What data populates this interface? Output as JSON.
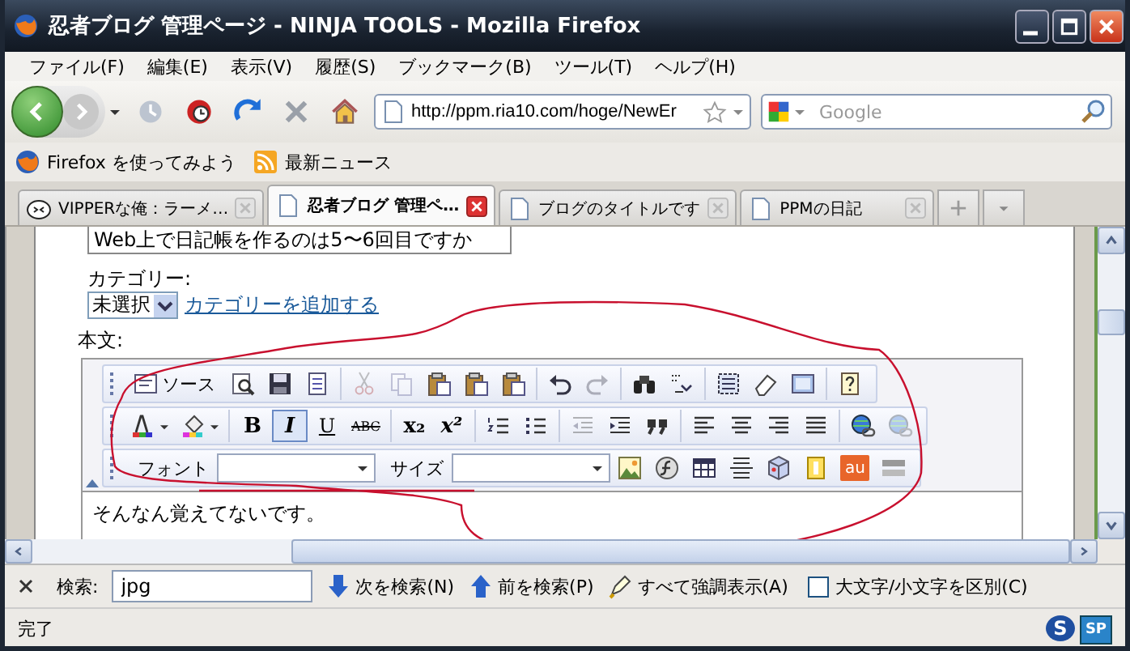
{
  "window": {
    "title": "忍者ブログ 管理ページ - NINJA TOOLS - Mozilla Firefox"
  },
  "menu": [
    "ファイル(F)",
    "編集(E)",
    "表示(V)",
    "履歴(S)",
    "ブックマーク(B)",
    "ツール(T)",
    "ヘルプ(H)"
  ],
  "address": {
    "value": "http://ppm.ria10.com/hoge/NewEr"
  },
  "search": {
    "placeholder": "Google"
  },
  "bookmarks": [
    {
      "kind": "firefox",
      "label": "Firefox を使ってみよう"
    },
    {
      "kind": "feed",
      "label": "最新ニュース"
    }
  ],
  "tabs": [
    {
      "kind": "site",
      "label": "VIPPERな俺：ラーメ…",
      "selected": false
    },
    {
      "kind": "page",
      "label": "忍者ブログ 管理ペ…",
      "selected": true
    },
    {
      "kind": "page",
      "label": "ブログのタイトルです",
      "selected": false
    },
    {
      "kind": "page",
      "label": "PPMの日記",
      "selected": false
    }
  ],
  "form": {
    "title_value": "Web上で日記帳を作るのは5〜6回目ですか",
    "category_label": "カテゴリー:",
    "category_value": "未選択",
    "category_link": "カテゴリーを追加する",
    "body_label": "本文:"
  },
  "editor": {
    "toolbars": [
      [
        [
          {
            "kind": "source",
            "label": "ソース",
            "disabled": false,
            "on": false
          },
          {
            "kind": "preview",
            "disabled": false,
            "on": false
          },
          {
            "kind": "save",
            "disabled": false,
            "on": false
          },
          {
            "kind": "template",
            "disabled": false,
            "on": false
          }
        ],
        [
          {
            "kind": "cut",
            "disabled": true,
            "on": false
          },
          {
            "kind": "copy",
            "disabled": true,
            "on": false
          },
          {
            "kind": "paste",
            "disabled": false,
            "on": false
          },
          {
            "kind": "paste",
            "disabled": false,
            "on": false
          },
          {
            "kind": "paste",
            "disabled": false,
            "on": false
          }
        ],
        [
          {
            "kind": "undo",
            "disabled": false,
            "on": false
          },
          {
            "kind": "redo",
            "disabled": true,
            "on": false
          }
        ],
        [
          {
            "kind": "find",
            "disabled": false,
            "on": false
          },
          {
            "kind": "replace",
            "disabled": false,
            "on": false
          }
        ],
        [
          {
            "kind": "select-all",
            "disabled": false,
            "on": false
          },
          {
            "kind": "eraser",
            "disabled": false,
            "on": false
          },
          {
            "kind": "frame",
            "disabled": false,
            "on": false
          }
        ],
        [
          {
            "kind": "help",
            "disabled": false,
            "on": false
          }
        ]
      ],
      [
        [
          {
            "kind": "text-color",
            "disabled": false,
            "on": false
          },
          {
            "kind": "bg-color",
            "disabled": false,
            "on": false
          }
        ],
        [
          {
            "kind": "glyph",
            "label": "B",
            "disabled": false,
            "on": false
          },
          {
            "kind": "glyph",
            "label": "I",
            "disabled": false,
            "on": true
          },
          {
            "kind": "glyph",
            "label": "U",
            "disabled": false,
            "on": false
          },
          {
            "kind": "glyph",
            "label": "ABC",
            "disabled": false,
            "on": false
          }
        ],
        [
          {
            "kind": "glyph",
            "label": "x₂",
            "disabled": false,
            "on": false
          },
          {
            "kind": "glyph",
            "label": "x²",
            "disabled": false,
            "on": false
          }
        ],
        [
          {
            "kind": "numbered-list",
            "disabled": false,
            "on": false
          },
          {
            "kind": "bullet-list",
            "disabled": false,
            "on": false
          }
        ],
        [
          {
            "kind": "outdent",
            "disabled": true,
            "on": false
          },
          {
            "kind": "indent",
            "disabled": false,
            "on": false
          },
          {
            "kind": "quote",
            "disabled": false,
            "on": false
          }
        ],
        [
          {
            "kind": "align-left",
            "disabled": false,
            "on": false
          },
          {
            "kind": "align-center",
            "disabled": false,
            "on": false
          },
          {
            "kind": "align-right",
            "disabled": false,
            "on": false
          },
          {
            "kind": "align-justify",
            "disabled": false,
            "on": false
          }
        ],
        [
          {
            "kind": "link",
            "disabled": false,
            "on": false
          },
          {
            "kind": "link",
            "disabled": true,
            "on": false
          }
        ]
      ],
      [
        [
          {
            "kind": "label",
            "label": "フォント",
            "disabled": false
          },
          {
            "kind": "select",
            "disabled": false,
            "on": false
          },
          {
            "kind": "label",
            "label": "サイズ",
            "disabled": false
          },
          {
            "kind": "select",
            "disabled": false,
            "on": false
          },
          {
            "kind": "image",
            "disabled": false,
            "on": false
          },
          {
            "kind": "flash",
            "disabled": false,
            "on": false
          },
          {
            "kind": "table",
            "disabled": false,
            "on": false
          },
          {
            "kind": "rule",
            "disabled": false,
            "on": false
          },
          {
            "kind": "cube",
            "disabled": false,
            "on": false
          },
          {
            "kind": "note",
            "disabled": false,
            "on": false
          },
          {
            "kind": "tag",
            "label": "au",
            "disabled": false,
            "on": false
          },
          {
            "kind": "bar",
            "disabled": false,
            "on": false
          }
        ]
      ]
    ],
    "content": "そんなん覚えてないです。"
  },
  "find_bar": {
    "label": "検索:",
    "value": "jpg",
    "next": "次を検索(N)",
    "previous": "前を検索(P)",
    "highlight_all": "すべて強調表示(A)",
    "match_case": {
      "label": "大文字/小文字を区別(C)",
      "checked": false
    }
  },
  "status_bar": {
    "text": "完了",
    "badges": [
      "S",
      "SP"
    ]
  }
}
